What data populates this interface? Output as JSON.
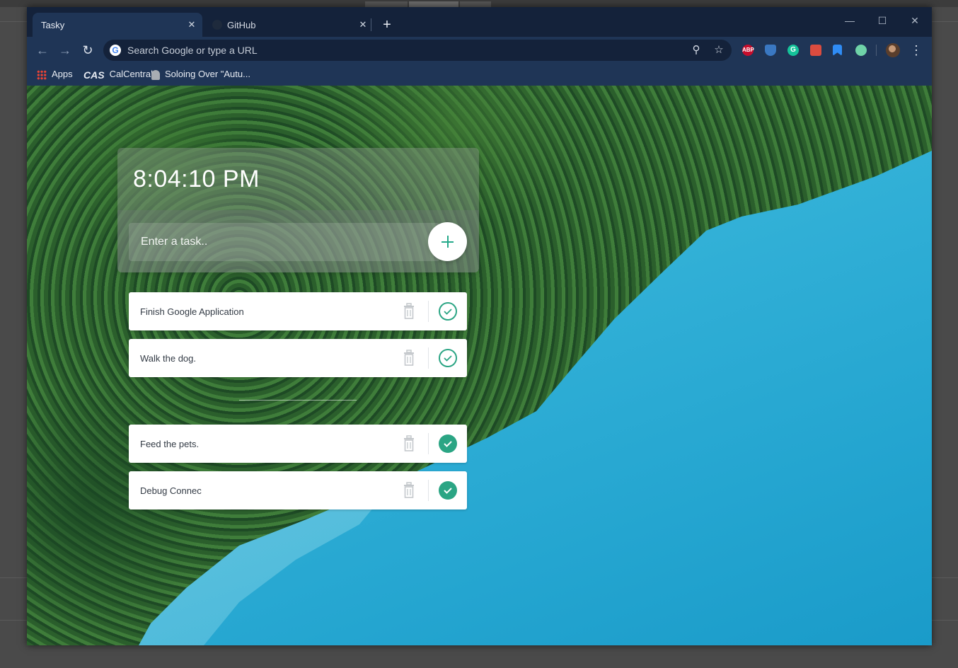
{
  "browser": {
    "tabs": [
      {
        "title": "Tasky",
        "active": true
      },
      {
        "title": "GitHub",
        "active": false
      }
    ],
    "omnibox_placeholder": "Search Google or type a URL",
    "bookmarks": [
      {
        "label": "Apps",
        "icon": "apps-grid-icon"
      },
      {
        "label": "CalCentral",
        "icon": "cas-logo-icon"
      },
      {
        "label": "Soloing Over \"Autu...",
        "icon": "page-icon"
      }
    ],
    "extensions": [
      {
        "name": "adblock-plus-icon",
        "text": "ABP",
        "color": "#c70d2c"
      },
      {
        "name": "shield-extension-icon",
        "text": "",
        "color": "#3a78c2"
      },
      {
        "name": "grammarly-icon",
        "text": "G",
        "color": "#15c39a"
      },
      {
        "name": "todoist-icon",
        "text": "",
        "color": "#db4c3f"
      },
      {
        "name": "bookmark-extension-icon",
        "text": "",
        "color": "#2f8cf5"
      },
      {
        "name": "circle-extension-icon",
        "text": "",
        "color": "#6fd3a8"
      }
    ]
  },
  "app": {
    "clock": "8:04:10 PM",
    "input_placeholder": "Enter a task..",
    "accent_color": "#2ba584",
    "tasks_todo": [
      {
        "text": "Finish Google Application",
        "done": false
      },
      {
        "text": "Walk the dog.",
        "done": false
      }
    ],
    "tasks_done": [
      {
        "text": "Feed the pets.",
        "done": true
      },
      {
        "text": "Debug Connec",
        "done": true
      }
    ]
  }
}
